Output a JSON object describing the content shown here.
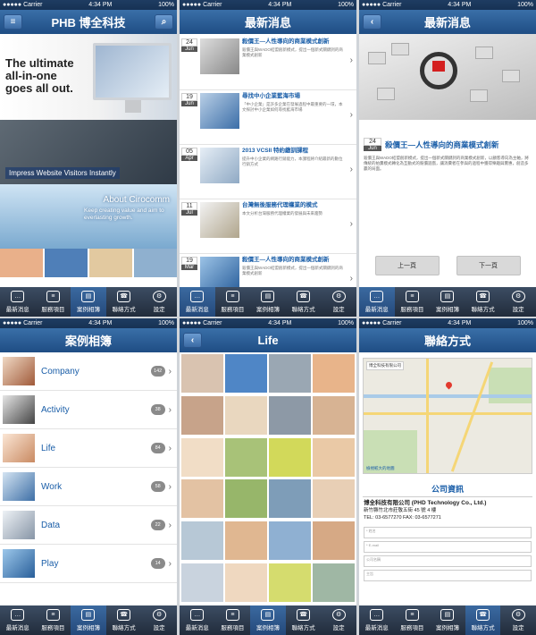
{
  "status": {
    "carrier": "●●●●● Carrier",
    "time": "4:34 PM",
    "battery": "100%"
  },
  "tabs": [
    "最新消息",
    "服務項目",
    "案例相簿",
    "聯絡方式",
    "設定"
  ],
  "s1": {
    "brand": "PHB 博全科技",
    "banner1": "The ultimate all-in-one goes all out.",
    "banner2": "Impress Website Visitors Instantly",
    "banner3_title": "About Cirocomm",
    "banner3_sub": "Keep creating value and aim to everlasting growth."
  },
  "s2": {
    "title": "最新消息",
    "items": [
      {
        "day": "24",
        "mon": "Jun",
        "title": "殺價王—人性導向的商業模式創新",
        "desc": "殺價王與WADO結盟創新模式，提出一個新式關鍵詞的商業模式創新"
      },
      {
        "day": "19",
        "mon": "Jun",
        "title": "尋找中小企業藍海市場",
        "desc": "「中小企業」是許多企業在發展過程中最重要的一環，本文探討中小企業如何尋找藍海市場"
      },
      {
        "day": "05",
        "mon": "Apr",
        "title": "2013 VCSII 特約繳訓課程",
        "desc": "提升中小企業的網路行銷能力，本課程將介紹最新的數位行銷方式"
      },
      {
        "day": "11",
        "mon": "Jul",
        "title": "台灣無後服務代理權業的模式",
        "desc": "本文分析台灣服務代理權業的發展與未來趨勢"
      },
      {
        "day": "19",
        "mon": "Mar",
        "title": "殺價王—人性導向的商業模式創新",
        "desc": "殺價王與WADO結盟創新模式，提出一個新式關鍵詞的商業模式創新"
      }
    ]
  },
  "s3": {
    "title": "最新消息",
    "day": "24",
    "mon": "Jun",
    "heading": "殺價王—人性導向的商業模式創新",
    "body": "殺價王與WADO結盟創新模式，提出一個新式關鍵詞的商業模式創新，以顧客導向為主軸，將傳統的拍賣模式轉化為互動式的競價遊戲，讓消費者在參與的過程中獲得樂趣與實惠，創造多贏的局面。",
    "prev": "上一頁",
    "next": "下一頁"
  },
  "s4": {
    "title": "案例相簿",
    "albums": [
      {
        "name": "Company",
        "count": "142"
      },
      {
        "name": "Activity",
        "count": "38"
      },
      {
        "name": "Life",
        "count": "84"
      },
      {
        "name": "Work",
        "count": "58"
      },
      {
        "name": "Data",
        "count": "22"
      },
      {
        "name": "Play",
        "count": "14"
      }
    ]
  },
  "s5": {
    "title": "Life"
  },
  "s6": {
    "title": "聯絡方式",
    "map_info": "博全科技有限公司",
    "map_link": "檢視較大的地圖",
    "section": "公司資訊",
    "company": "博全科技有限公司 (PHD Technology Co., Ltd.)",
    "address": "新竹縣竹北市莊敬五街 45 號 4 樓",
    "tel": "TEL: 03-6577270 FAX: 03-6577271",
    "f1": "* 姓名",
    "f2": "* E-mail",
    "f3": "公司名稱",
    "f4": "主旨"
  },
  "colors": {
    "nav": "#1f4d84",
    "link": "#1a5ea8",
    "tabbar": "#212c3b"
  }
}
